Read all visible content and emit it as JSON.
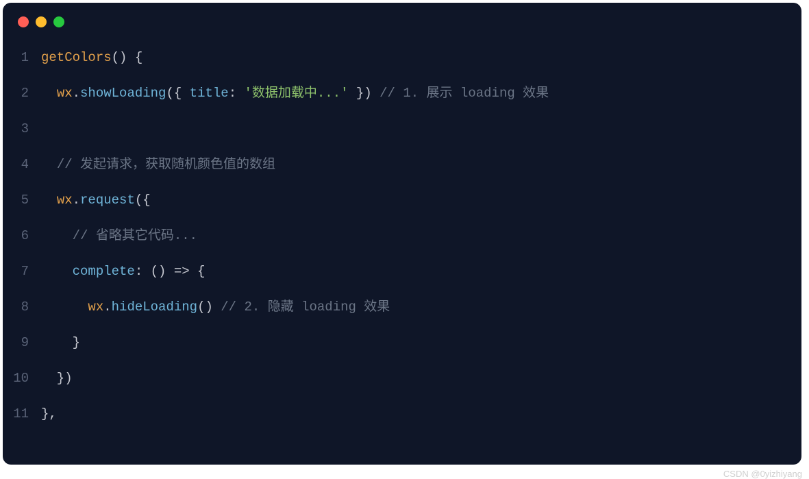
{
  "watermark": "CSDN @0yizhiyang",
  "lines": [
    {
      "num": "1",
      "tokens": [
        {
          "cls": "tok-func",
          "text": "getColors"
        },
        {
          "cls": "tok-punct",
          "text": "() {"
        }
      ]
    },
    {
      "num": "2",
      "tokens": [
        {
          "cls": "tok-punct",
          "text": "  "
        },
        {
          "cls": "tok-obj",
          "text": "wx"
        },
        {
          "cls": "tok-punct",
          "text": "."
        },
        {
          "cls": "tok-method",
          "text": "showLoading"
        },
        {
          "cls": "tok-punct",
          "text": "({ "
        },
        {
          "cls": "tok-prop",
          "text": "title"
        },
        {
          "cls": "tok-punct",
          "text": ": "
        },
        {
          "cls": "tok-string",
          "text": "'数据加载中...'"
        },
        {
          "cls": "tok-punct",
          "text": " }) "
        },
        {
          "cls": "tok-comment",
          "text": "// 1. 展示 loading 效果"
        }
      ]
    },
    {
      "num": "3",
      "tokens": []
    },
    {
      "num": "4",
      "tokens": [
        {
          "cls": "tok-punct",
          "text": "  "
        },
        {
          "cls": "tok-comment",
          "text": "// 发起请求，获取随机颜色值的数组"
        }
      ]
    },
    {
      "num": "5",
      "tokens": [
        {
          "cls": "tok-punct",
          "text": "  "
        },
        {
          "cls": "tok-obj",
          "text": "wx"
        },
        {
          "cls": "tok-punct",
          "text": "."
        },
        {
          "cls": "tok-method",
          "text": "request"
        },
        {
          "cls": "tok-punct",
          "text": "({"
        }
      ]
    },
    {
      "num": "6",
      "tokens": [
        {
          "cls": "tok-punct",
          "text": "    "
        },
        {
          "cls": "tok-comment",
          "text": "// 省略其它代码..."
        }
      ]
    },
    {
      "num": "7",
      "tokens": [
        {
          "cls": "tok-punct",
          "text": "    "
        },
        {
          "cls": "tok-prop",
          "text": "complete"
        },
        {
          "cls": "tok-punct",
          "text": ": () "
        },
        {
          "cls": "tok-arrow",
          "text": "=>"
        },
        {
          "cls": "tok-punct",
          "text": " {"
        }
      ]
    },
    {
      "num": "8",
      "tokens": [
        {
          "cls": "tok-punct",
          "text": "      "
        },
        {
          "cls": "tok-obj",
          "text": "wx"
        },
        {
          "cls": "tok-punct",
          "text": "."
        },
        {
          "cls": "tok-method",
          "text": "hideLoading"
        },
        {
          "cls": "tok-punct",
          "text": "() "
        },
        {
          "cls": "tok-comment",
          "text": "// 2. 隐藏 loading 效果"
        }
      ]
    },
    {
      "num": "9",
      "tokens": [
        {
          "cls": "tok-punct",
          "text": "    }"
        }
      ]
    },
    {
      "num": "10",
      "tokens": [
        {
          "cls": "tok-punct",
          "text": "  })"
        }
      ]
    },
    {
      "num": "11",
      "tokens": [
        {
          "cls": "tok-punct",
          "text": "},"
        }
      ]
    }
  ]
}
